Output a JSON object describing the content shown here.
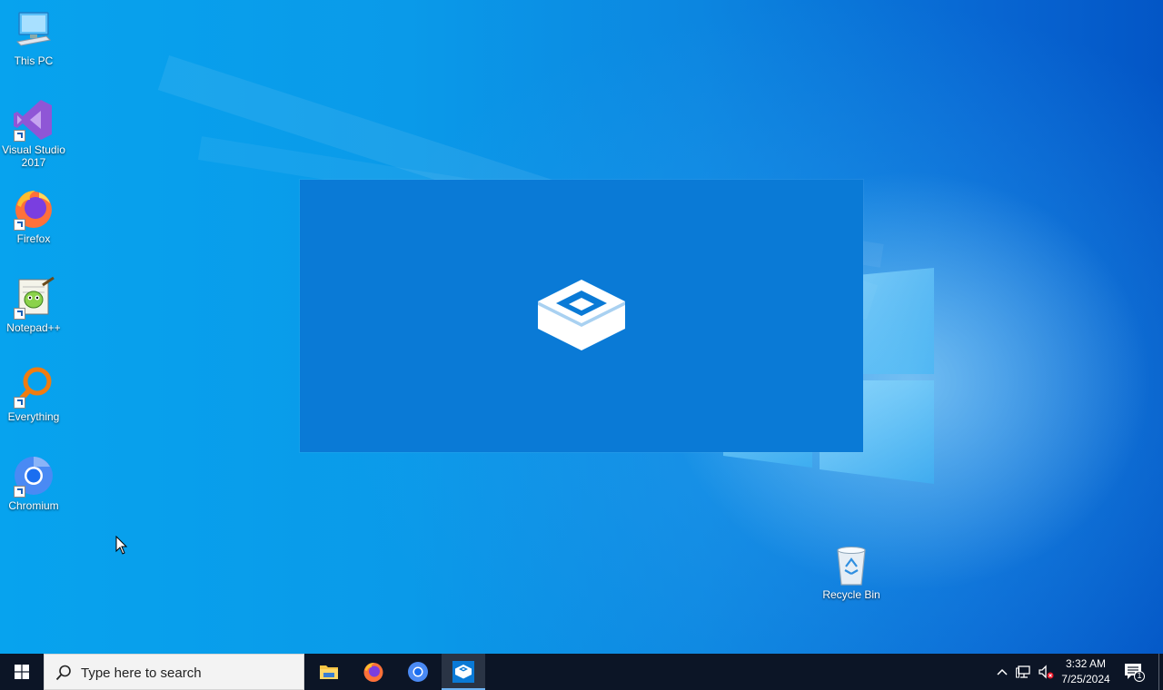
{
  "desktop": {
    "icons": [
      {
        "label": "This PC",
        "icon": "monitor-icon",
        "shortcut": false
      },
      {
        "label": "Visual Studio 2017",
        "icon": "visual-studio-icon",
        "shortcut": true
      },
      {
        "label": "Firefox",
        "icon": "firefox-icon",
        "shortcut": true
      },
      {
        "label": "Notepad++",
        "icon": "notepadpp-icon",
        "shortcut": true
      },
      {
        "label": "Everything",
        "icon": "everything-icon",
        "shortcut": true
      },
      {
        "label": "Chromium",
        "icon": "chromium-icon",
        "shortcut": true
      }
    ],
    "recycle_bin": {
      "label": "Recycle Bin",
      "icon": "recycle-bin-icon"
    }
  },
  "splash": {
    "icon": "sandbox-box-icon",
    "color": "#0a7ad6"
  },
  "taskbar": {
    "search_placeholder": "Type here to search",
    "pinned": [
      {
        "name": "File Explorer",
        "icon": "folder-icon",
        "active": false
      },
      {
        "name": "Firefox",
        "icon": "firefox-icon",
        "active": false
      },
      {
        "name": "Chromium",
        "icon": "chromium-icon",
        "active": false
      },
      {
        "name": "Windows Sandbox",
        "icon": "sandbox-box-icon",
        "active": true
      }
    ],
    "tray": {
      "icons": [
        "chevron-up-icon",
        "network-icon",
        "volume-muted-icon"
      ],
      "time": "3:32 AM",
      "date": "7/25/2024",
      "notification_count": "1"
    }
  },
  "colors": {
    "taskbar": "#0c1526",
    "accent": "#0a7ad6",
    "active_underline": "#6db2f2"
  }
}
